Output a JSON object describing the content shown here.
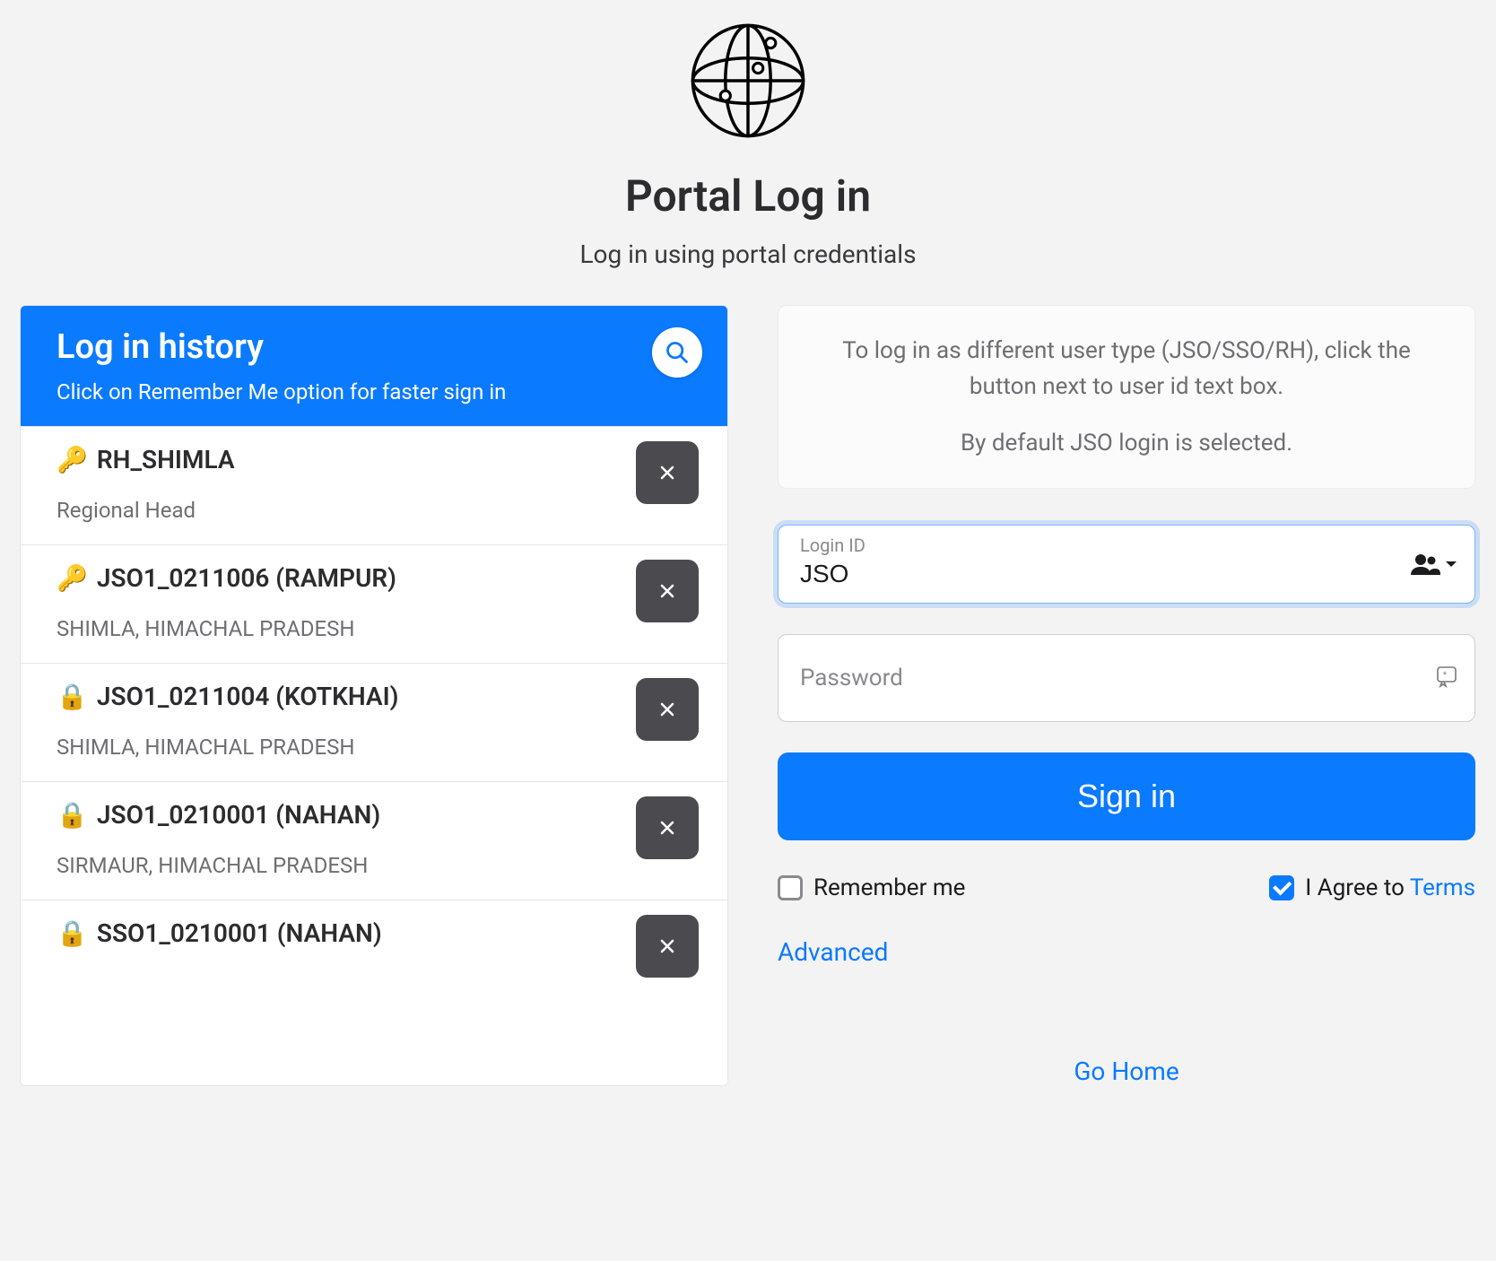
{
  "header": {
    "title": "Portal Log in",
    "subtitle": "Log in using portal credentials"
  },
  "history": {
    "title": "Log in history",
    "subtitle": "Click on Remember Me option for faster sign in",
    "items": [
      {
        "icon": "🔑",
        "name": "RH_SHIMLA",
        "meta": "Regional Head"
      },
      {
        "icon": "🔑",
        "name": "JSO1_0211006 (RAMPUR)",
        "meta": "SHIMLA, HIMACHAL PRADESH"
      },
      {
        "icon": "🔒",
        "name": "JSO1_0211004 (KOTKHAI)",
        "meta": "SHIMLA, HIMACHAL PRADESH"
      },
      {
        "icon": "🔒",
        "name": "JSO1_0210001 (NAHAN)",
        "meta": "SIRMAUR, HIMACHAL PRADESH"
      },
      {
        "icon": "🔒",
        "name": "SSO1_0210001 (NAHAN)",
        "meta": ""
      }
    ]
  },
  "info": {
    "line1": "To log in as different user type (JSO/SSO/RH), click the button next to user id text box.",
    "line2": "By default JSO login is selected."
  },
  "form": {
    "login_label": "Login ID",
    "login_value": "JSO",
    "password_label": "Password",
    "signin_label": "Sign in",
    "remember_label": "Remember me",
    "agree_prefix": "I Agree to ",
    "terms_label": "Terms",
    "advanced_label": "Advanced",
    "go_home_label": "Go Home"
  }
}
